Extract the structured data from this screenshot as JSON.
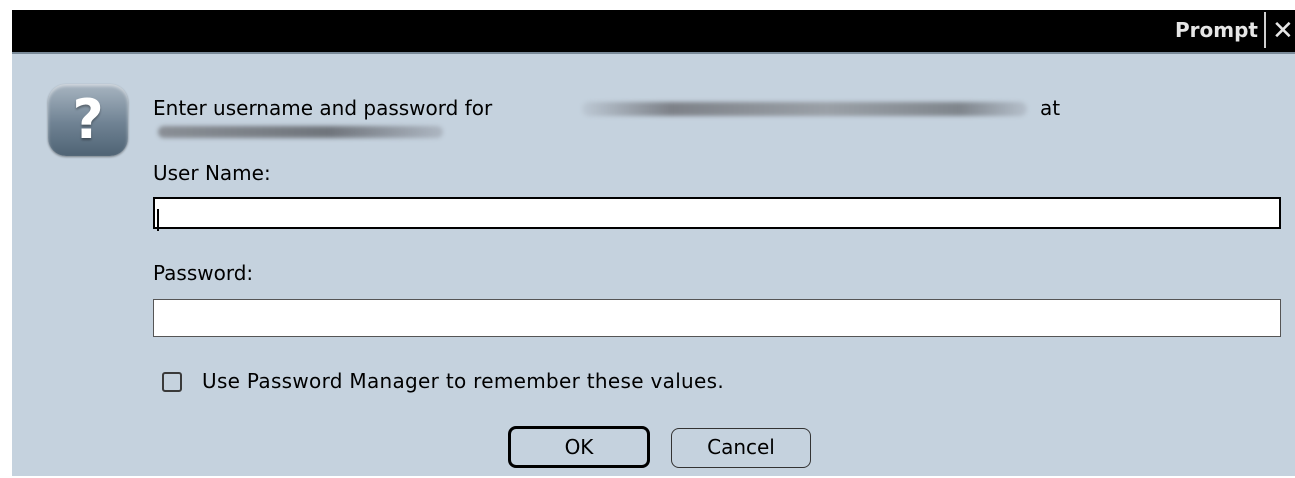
{
  "window": {
    "title": "Prompt",
    "close_glyph": "✕"
  },
  "icon": {
    "name": "question-icon",
    "glyph": "?"
  },
  "message": {
    "prefix": "Enter username and password for",
    "suffix": "at"
  },
  "username": {
    "label": "User Name:",
    "value": ""
  },
  "password": {
    "label": "Password:",
    "value": ""
  },
  "remember": {
    "label": "Use Password Manager to remember these values.",
    "checked": false
  },
  "buttons": {
    "ok": "OK",
    "cancel": "Cancel"
  },
  "colors": {
    "dialog_bg": "#c5d2de",
    "titlebar_bg": "#000000"
  }
}
